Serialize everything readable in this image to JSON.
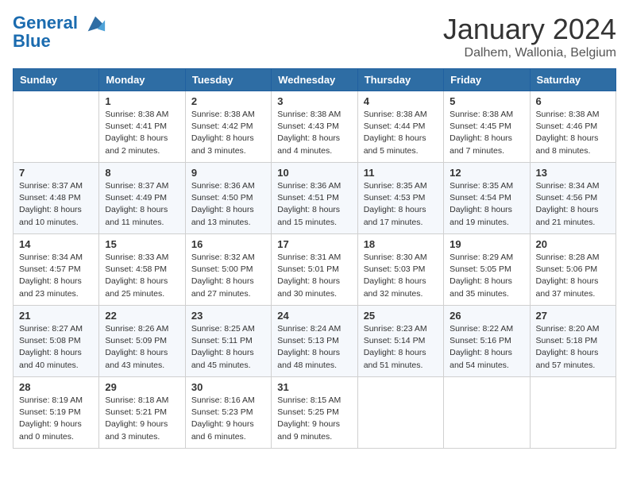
{
  "header": {
    "logo_line1": "General",
    "logo_line2": "Blue",
    "month": "January 2024",
    "location": "Dalhem, Wallonia, Belgium"
  },
  "weekdays": [
    "Sunday",
    "Monday",
    "Tuesday",
    "Wednesday",
    "Thursday",
    "Friday",
    "Saturday"
  ],
  "weeks": [
    [
      {
        "day": "",
        "info": ""
      },
      {
        "day": "1",
        "info": "Sunrise: 8:38 AM\nSunset: 4:41 PM\nDaylight: 8 hours\nand 2 minutes."
      },
      {
        "day": "2",
        "info": "Sunrise: 8:38 AM\nSunset: 4:42 PM\nDaylight: 8 hours\nand 3 minutes."
      },
      {
        "day": "3",
        "info": "Sunrise: 8:38 AM\nSunset: 4:43 PM\nDaylight: 8 hours\nand 4 minutes."
      },
      {
        "day": "4",
        "info": "Sunrise: 8:38 AM\nSunset: 4:44 PM\nDaylight: 8 hours\nand 5 minutes."
      },
      {
        "day": "5",
        "info": "Sunrise: 8:38 AM\nSunset: 4:45 PM\nDaylight: 8 hours\nand 7 minutes."
      },
      {
        "day": "6",
        "info": "Sunrise: 8:38 AM\nSunset: 4:46 PM\nDaylight: 8 hours\nand 8 minutes."
      }
    ],
    [
      {
        "day": "7",
        "info": "Sunrise: 8:37 AM\nSunset: 4:48 PM\nDaylight: 8 hours\nand 10 minutes."
      },
      {
        "day": "8",
        "info": "Sunrise: 8:37 AM\nSunset: 4:49 PM\nDaylight: 8 hours\nand 11 minutes."
      },
      {
        "day": "9",
        "info": "Sunrise: 8:36 AM\nSunset: 4:50 PM\nDaylight: 8 hours\nand 13 minutes."
      },
      {
        "day": "10",
        "info": "Sunrise: 8:36 AM\nSunset: 4:51 PM\nDaylight: 8 hours\nand 15 minutes."
      },
      {
        "day": "11",
        "info": "Sunrise: 8:35 AM\nSunset: 4:53 PM\nDaylight: 8 hours\nand 17 minutes."
      },
      {
        "day": "12",
        "info": "Sunrise: 8:35 AM\nSunset: 4:54 PM\nDaylight: 8 hours\nand 19 minutes."
      },
      {
        "day": "13",
        "info": "Sunrise: 8:34 AM\nSunset: 4:56 PM\nDaylight: 8 hours\nand 21 minutes."
      }
    ],
    [
      {
        "day": "14",
        "info": "Sunrise: 8:34 AM\nSunset: 4:57 PM\nDaylight: 8 hours\nand 23 minutes."
      },
      {
        "day": "15",
        "info": "Sunrise: 8:33 AM\nSunset: 4:58 PM\nDaylight: 8 hours\nand 25 minutes."
      },
      {
        "day": "16",
        "info": "Sunrise: 8:32 AM\nSunset: 5:00 PM\nDaylight: 8 hours\nand 27 minutes."
      },
      {
        "day": "17",
        "info": "Sunrise: 8:31 AM\nSunset: 5:01 PM\nDaylight: 8 hours\nand 30 minutes."
      },
      {
        "day": "18",
        "info": "Sunrise: 8:30 AM\nSunset: 5:03 PM\nDaylight: 8 hours\nand 32 minutes."
      },
      {
        "day": "19",
        "info": "Sunrise: 8:29 AM\nSunset: 5:05 PM\nDaylight: 8 hours\nand 35 minutes."
      },
      {
        "day": "20",
        "info": "Sunrise: 8:28 AM\nSunset: 5:06 PM\nDaylight: 8 hours\nand 37 minutes."
      }
    ],
    [
      {
        "day": "21",
        "info": "Sunrise: 8:27 AM\nSunset: 5:08 PM\nDaylight: 8 hours\nand 40 minutes."
      },
      {
        "day": "22",
        "info": "Sunrise: 8:26 AM\nSunset: 5:09 PM\nDaylight: 8 hours\nand 43 minutes."
      },
      {
        "day": "23",
        "info": "Sunrise: 8:25 AM\nSunset: 5:11 PM\nDaylight: 8 hours\nand 45 minutes."
      },
      {
        "day": "24",
        "info": "Sunrise: 8:24 AM\nSunset: 5:13 PM\nDaylight: 8 hours\nand 48 minutes."
      },
      {
        "day": "25",
        "info": "Sunrise: 8:23 AM\nSunset: 5:14 PM\nDaylight: 8 hours\nand 51 minutes."
      },
      {
        "day": "26",
        "info": "Sunrise: 8:22 AM\nSunset: 5:16 PM\nDaylight: 8 hours\nand 54 minutes."
      },
      {
        "day": "27",
        "info": "Sunrise: 8:20 AM\nSunset: 5:18 PM\nDaylight: 8 hours\nand 57 minutes."
      }
    ],
    [
      {
        "day": "28",
        "info": "Sunrise: 8:19 AM\nSunset: 5:19 PM\nDaylight: 9 hours\nand 0 minutes."
      },
      {
        "day": "29",
        "info": "Sunrise: 8:18 AM\nSunset: 5:21 PM\nDaylight: 9 hours\nand 3 minutes."
      },
      {
        "day": "30",
        "info": "Sunrise: 8:16 AM\nSunset: 5:23 PM\nDaylight: 9 hours\nand 6 minutes."
      },
      {
        "day": "31",
        "info": "Sunrise: 8:15 AM\nSunset: 5:25 PM\nDaylight: 9 hours\nand 9 minutes."
      },
      {
        "day": "",
        "info": ""
      },
      {
        "day": "",
        "info": ""
      },
      {
        "day": "",
        "info": ""
      }
    ]
  ]
}
